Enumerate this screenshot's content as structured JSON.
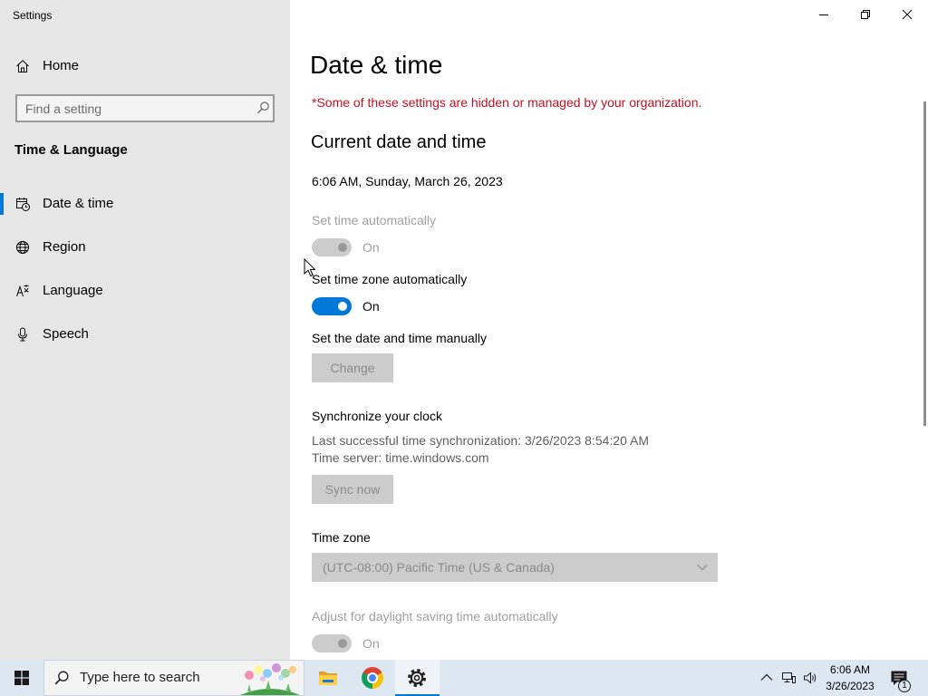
{
  "window": {
    "title": "Settings",
    "controls": [
      "minimize-icon",
      "restore-icon",
      "close-icon"
    ]
  },
  "sidebar": {
    "home": {
      "label": "Home",
      "icon": "home-icon"
    },
    "search": {
      "placeholder": "Find a setting",
      "icon": "search-icon"
    },
    "section_title": "Time & Language",
    "items": [
      {
        "label": "Date & time",
        "icon": "date-time-icon",
        "selected": true
      },
      {
        "label": "Region",
        "icon": "globe-icon",
        "selected": false
      },
      {
        "label": "Language",
        "icon": "language-icon",
        "selected": false
      },
      {
        "label": "Speech",
        "icon": "microphone-icon",
        "selected": false
      }
    ]
  },
  "main": {
    "title": "Date & time",
    "org_notice": "*Some of these settings are hidden or managed by your organization.",
    "current": {
      "heading": "Current date and time",
      "value": "6:06 AM, Sunday, March 26, 2023"
    },
    "set_time_auto": {
      "label": "Set time automatically",
      "state_label": "On",
      "on": true,
      "disabled": true
    },
    "set_time_zone_auto": {
      "label": "Set time zone automatically",
      "state_label": "On",
      "on": true,
      "disabled": false
    },
    "manual": {
      "label": "Set the date and time manually",
      "button_label": "Change",
      "disabled": true
    },
    "sync": {
      "heading": "Synchronize your clock",
      "last_sync": "Last successful time synchronization: 3/26/2023 8:54:20 AM",
      "server": "Time server: time.windows.com",
      "button_label": "Sync now",
      "disabled": true
    },
    "time_zone": {
      "label": "Time zone",
      "selected": "(UTC-08:00) Pacific Time (US & Canada)",
      "disabled": true,
      "icon": "chevron-down-icon"
    },
    "dst_auto": {
      "label": "Adjust for daylight saving time automatically",
      "state_label": "On",
      "on": true,
      "disabled": true
    }
  },
  "taskbar": {
    "start_icon": "windows-logo-icon",
    "search": {
      "placeholder": "Type here to search",
      "icon": "search-icon"
    },
    "pinned": [
      {
        "icon": "file-explorer-icon",
        "active": false
      },
      {
        "icon": "chrome-icon",
        "active": false
      },
      {
        "icon": "settings-gear-icon",
        "active": true
      }
    ],
    "tray": {
      "icons": [
        "chevron-up-icon",
        "network-icon",
        "volume-icon"
      ],
      "time": "6:06 AM",
      "date": "3/26/2023",
      "notifications_icon": "action-center-icon",
      "notification_count": "1"
    }
  },
  "colors": {
    "accent": "#0078d7",
    "notice": "#c50f1f"
  }
}
